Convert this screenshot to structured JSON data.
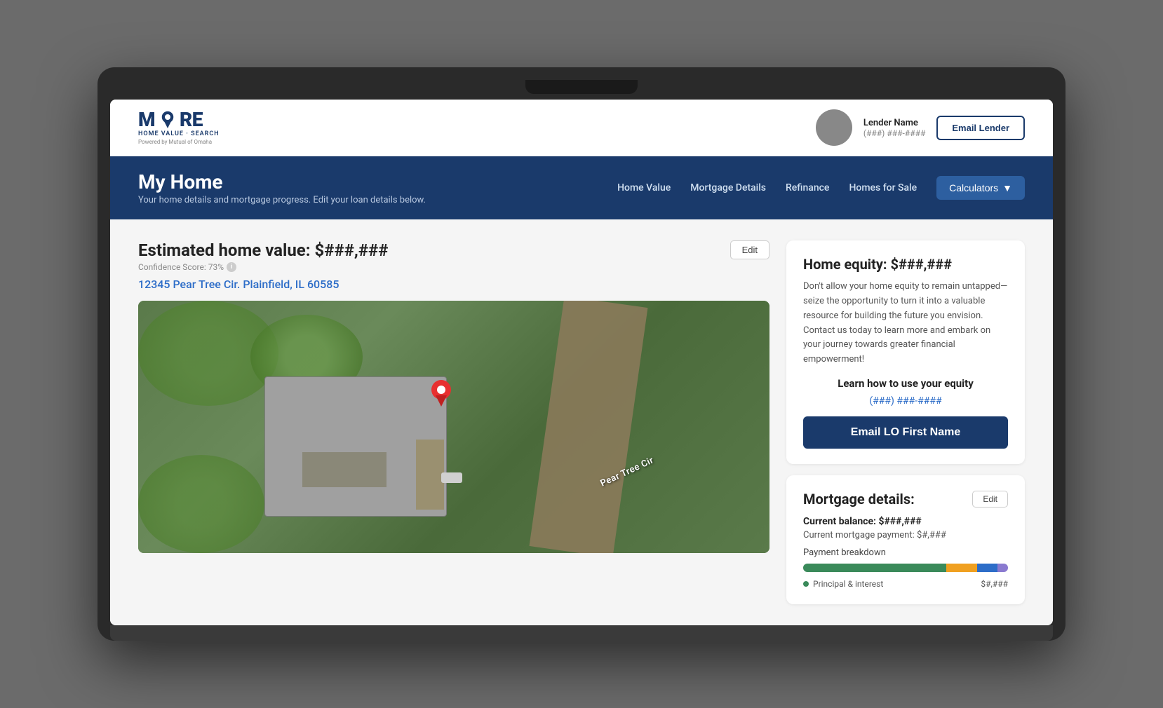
{
  "logo": {
    "main_text": "MORE",
    "subtitle": "HOME VALUE · SEARCH",
    "powered_by": "Powered by Mutual of Omaha"
  },
  "header": {
    "lender_name": "Lender Name",
    "lender_phone": "(###) ###-####",
    "email_lender_label": "Email Lender"
  },
  "nav": {
    "page_title": "My Home",
    "page_subtitle": "Your home details and mortgage progress. Edit your loan details below.",
    "links": [
      "Home Value",
      "Mortgage Details",
      "Refinance",
      "Homes for Sale"
    ],
    "calculators_label": "Calculators"
  },
  "property": {
    "estimated_value_label": "Estimated home value: $###,###",
    "confidence_score": "Confidence Score: 73%",
    "address": "12345 Pear Tree Cir. Plainfield, IL 60585",
    "edit_label": "Edit",
    "map_street_label": "Pear Tree Cir"
  },
  "equity_card": {
    "title": "Home equity: $###,###",
    "body_text": "Don't allow your home equity to remain untapped—seize the opportunity to turn it into a valuable resource for building the future you envision. Contact us today to learn more and embark on your journey towards greater financial empowerment!",
    "learn_label": "Learn how to use your equity",
    "phone": "(###) ###-####",
    "email_lo_label": "Email LO First Name"
  },
  "mortgage_card": {
    "title": "Mortgage details:",
    "edit_label": "Edit",
    "balance_label": "Current balance: $###,###",
    "payment_label": "Current mortgage payment: $#,###",
    "breakdown_title": "Payment breakdown",
    "breakdown_items": [
      {
        "label": "Principal & interest",
        "value": "$#,###",
        "color": "#3a8a5a"
      }
    ]
  }
}
